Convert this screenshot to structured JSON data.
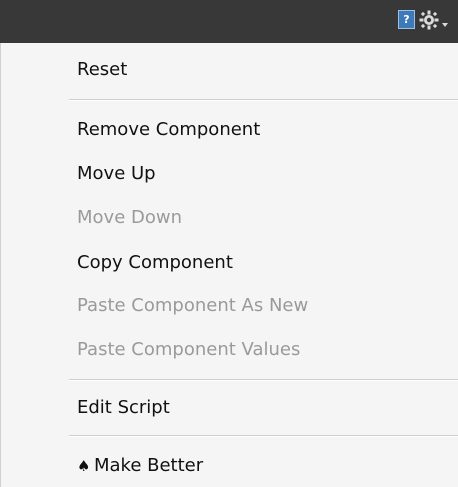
{
  "topbar": {
    "help_icon": "help-icon",
    "help_glyph": "?",
    "settings_icon": "gear-dropdown-icon"
  },
  "menu": {
    "reset": "Reset",
    "remove_component": "Remove Component",
    "move_up": "Move Up",
    "move_down": "Move Down",
    "copy_component": "Copy Component",
    "paste_as_new": "Paste Component As New",
    "paste_values": "Paste Component Values",
    "edit_script": "Edit Script",
    "make_better": "Make Better",
    "make_better_icon": "spade-icon"
  },
  "colors": {
    "topbar_background": "#383838",
    "menu_background": "#f5f5f5",
    "enabled_text": "#111111",
    "disabled_text": "#9a9a9a",
    "help_icon": "#3e7ab8"
  }
}
